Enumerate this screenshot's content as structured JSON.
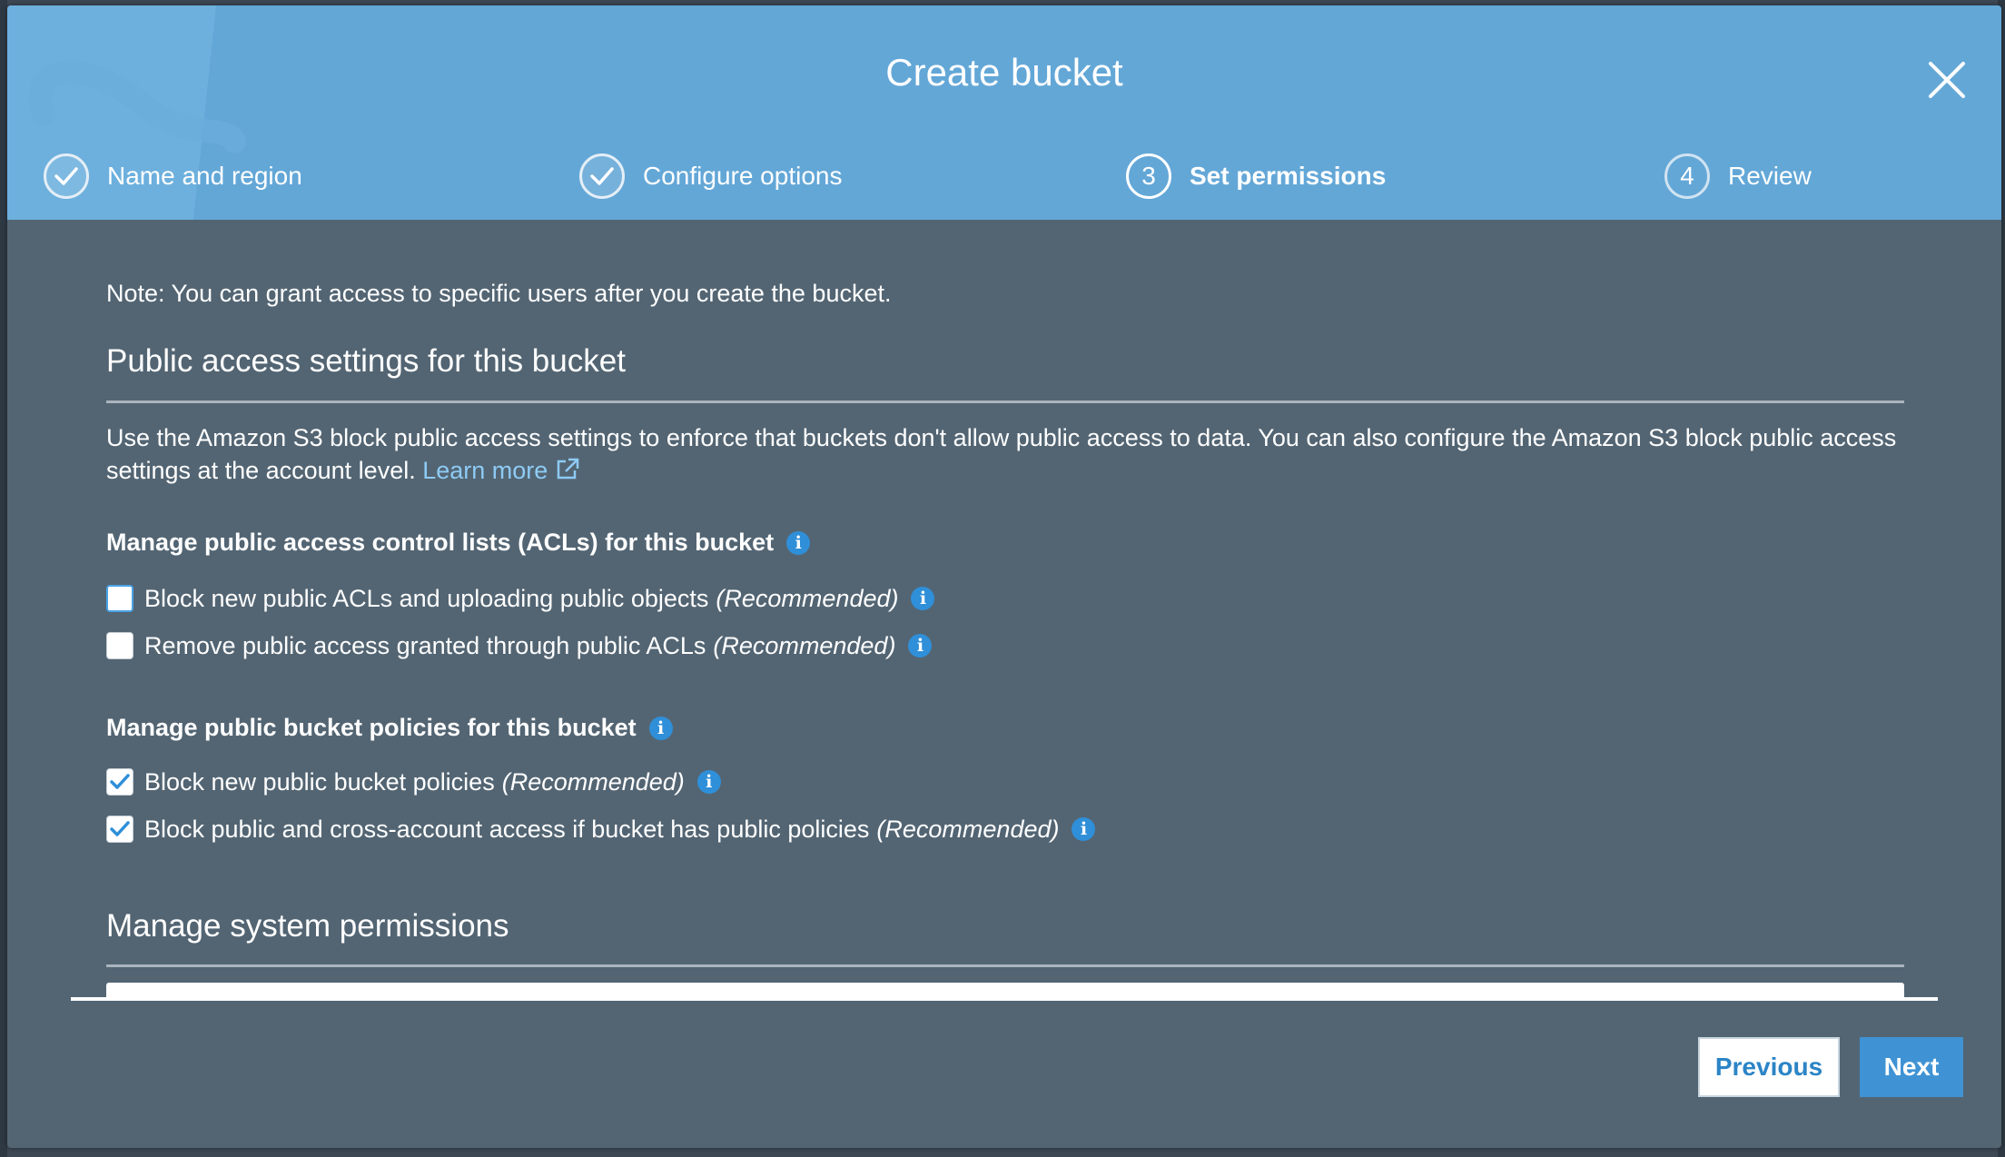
{
  "modal": {
    "title": "Create bucket"
  },
  "steps": [
    {
      "number": "1",
      "label": "Name and region",
      "status": "complete"
    },
    {
      "number": "2",
      "label": "Configure options",
      "status": "complete"
    },
    {
      "number": "3",
      "label": "Set permissions",
      "status": "active"
    },
    {
      "number": "4",
      "label": "Review",
      "status": "pending"
    }
  ],
  "content": {
    "note": "Note: You can grant access to specific users after you create the bucket.",
    "public_access_title": "Public access settings for this bucket",
    "description": "Use the Amazon S3 block public access settings to enforce that buckets don't allow public access to data. You can also configure the Amazon S3 block public access settings at the account level.",
    "learn_more": "Learn more",
    "acl_group": {
      "title": "Manage public access control lists (ACLs) for this bucket",
      "options": [
        {
          "label": "Block new public ACLs and uploading public objects",
          "tag": "(Recommended)",
          "checked": false
        },
        {
          "label": "Remove public access granted through public ACLs",
          "tag": "(Recommended)",
          "checked": false
        }
      ]
    },
    "policy_group": {
      "title": "Manage public bucket policies for this bucket",
      "options": [
        {
          "label": "Block new public bucket policies",
          "tag": "(Recommended)",
          "checked": true
        },
        {
          "label": "Block public and cross-account access if bucket has public policies",
          "tag": "(Recommended)",
          "checked": true
        }
      ]
    },
    "system_permissions_title": "Manage system permissions"
  },
  "footer": {
    "previous_label": "Previous",
    "next_label": "Next"
  },
  "colors": {
    "header_bg": "#63a7d7",
    "body_bg": "#536573",
    "link": "#8ecbf5",
    "checkbox_checked": "#2f8fd8",
    "primary_button": "#3f93d4"
  },
  "icons": {
    "close": "close-icon",
    "step_complete": "check-circle-icon",
    "info": "info-icon",
    "external_link": "external-link-icon",
    "checkmark": "checkmark-icon"
  }
}
